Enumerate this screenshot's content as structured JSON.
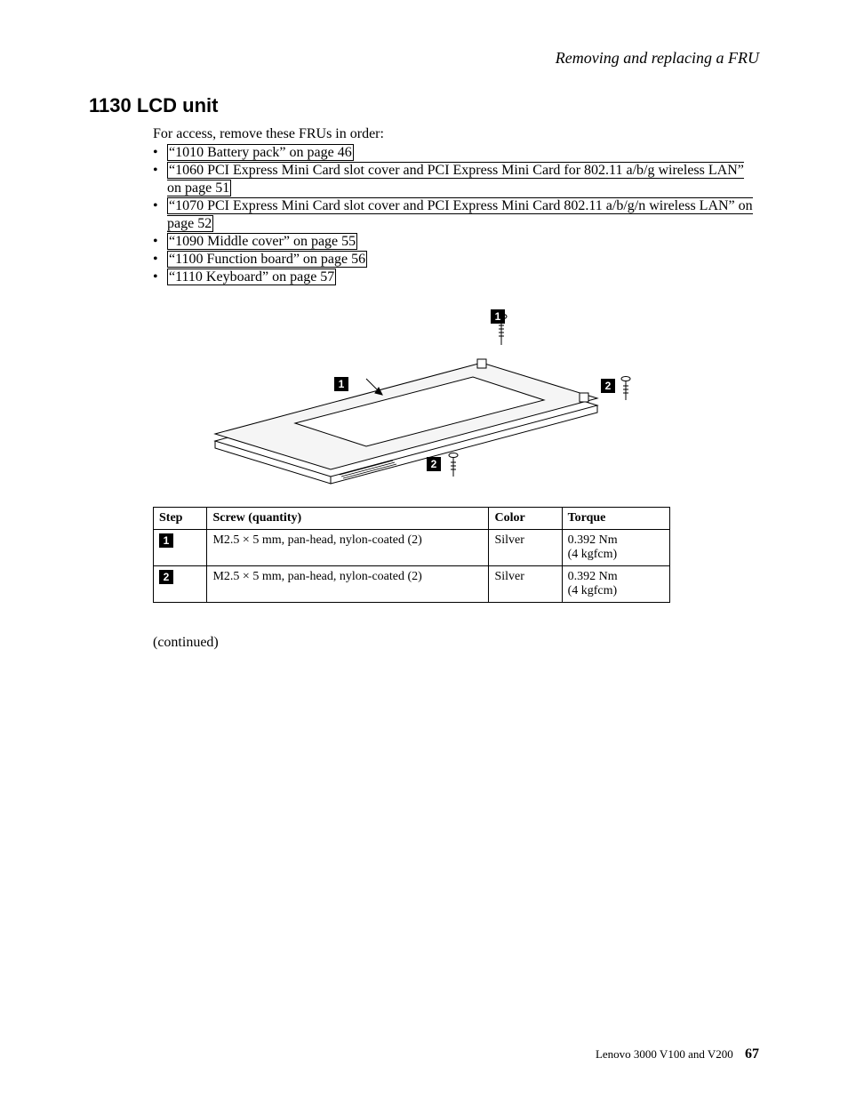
{
  "running_head": "Removing and replacing a FRU",
  "section_title": "1130 LCD unit",
  "intro": "For access, remove these FRUs in order:",
  "fru_links": [
    "“1010 Battery pack” on page 46",
    "“1060 PCI Express Mini Card slot cover and PCI Express Mini Card for 802.11 a/b/g wireless LAN” on page 51",
    "“1070 PCI Express Mini Card slot cover and PCI Express Mini Card 802.11 a/b/g/n wireless LAN” on page 52",
    "“1090 Middle cover” on page 55",
    "“1100 Function board” on page 56",
    "“1110 Keyboard” on page 57"
  ],
  "diagram_callouts": [
    "1",
    "2",
    "2"
  ],
  "table": {
    "headers": {
      "step": "Step",
      "screw": "Screw (quantity)",
      "color": "Color",
      "torque": "Torque"
    },
    "rows": [
      {
        "step": "1",
        "screw": "M2.5 × 5 mm, pan-head, nylon-coated (2)",
        "color": "Silver",
        "torque_line1": "0.392 Nm",
        "torque_line2": "(4 kgfcm)"
      },
      {
        "step": "2",
        "screw": "M2.5 × 5 mm, pan-head, nylon-coated (2)",
        "color": "Silver",
        "torque_line1": "0.392 Nm",
        "torque_line2": "(4 kgfcm)"
      }
    ]
  },
  "continued": "(continued)",
  "footer_model": "Lenovo 3000 V100 and V200",
  "footer_page": "67"
}
